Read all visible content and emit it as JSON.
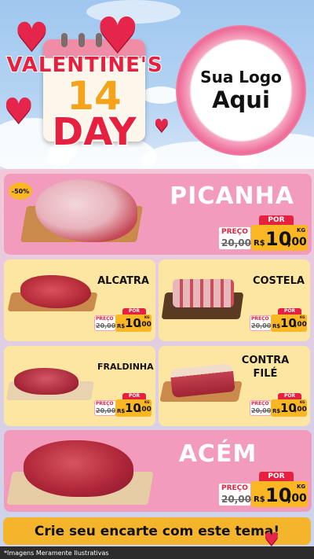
{
  "header": {
    "title_word": "VALENTINE'S",
    "title_number": "14",
    "title_day": "DAY",
    "logo_line1": "Sua Logo",
    "logo_line2": "Aqui"
  },
  "discount_badge": "-50%",
  "products": [
    {
      "name": "PICANHA",
      "por": "POR",
      "preco_label": "PREÇO",
      "old_price": "20,00",
      "currency": "R$",
      "price_int": "10",
      "price_dec": ",00",
      "unit": "KG"
    },
    {
      "name": "ALCATRA",
      "por": "POR",
      "preco_label": "PREÇO",
      "old_price": "20,00",
      "currency": "R$",
      "price_int": "10",
      "price_dec": ",00",
      "unit": "KG"
    },
    {
      "name": "COSTELA",
      "por": "POR",
      "preco_label": "PREÇO",
      "old_price": "20,00",
      "currency": "R$",
      "price_int": "10",
      "price_dec": ",00",
      "unit": "KG"
    },
    {
      "name": "FRALDINHA",
      "por": "POR",
      "preco_label": "PREÇO",
      "old_price": "20,00",
      "currency": "R$",
      "price_int": "10",
      "price_dec": ",00",
      "unit": "KG"
    },
    {
      "name_line1": "CONTRA",
      "name_line2": "FILÉ",
      "por": "POR",
      "preco_label": "PREÇO",
      "old_price": "20,00",
      "currency": "R$",
      "price_int": "10",
      "price_dec": ",00",
      "unit": "KG"
    },
    {
      "name": "ACÉM",
      "por": "POR",
      "preco_label": "PREÇO",
      "old_price": "20,00",
      "currency": "R$",
      "price_int": "10",
      "price_dec": ",00",
      "unit": "KG"
    }
  ],
  "banner_text": "Crie seu encarte com este tema!",
  "footer_text": "*Imagens Meramente Ilustrativas",
  "colors": {
    "accent_red": "#e5213f",
    "price_yellow": "#fbb623",
    "card_pink": "#f39bbd",
    "card_yellow": "#fde6a2"
  }
}
